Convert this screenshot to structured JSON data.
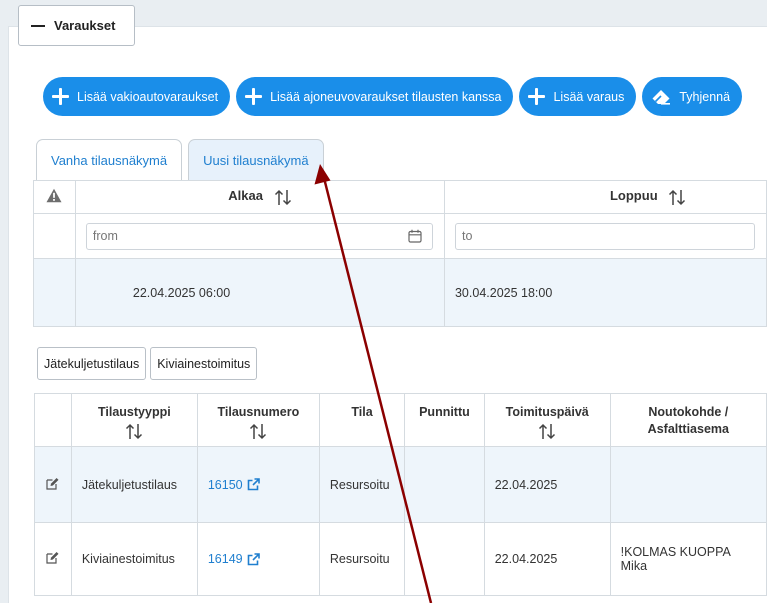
{
  "section": {
    "title": "Varaukset"
  },
  "actions": [
    {
      "label": "Lisää vakioautovaraukset"
    },
    {
      "label": "Lisää ajoneuvovaraukset tilausten kanssa"
    },
    {
      "label": "Lisää varaus"
    },
    {
      "label": "Tyhjennä"
    }
  ],
  "tabs": [
    {
      "label": "Vanha tilausnäkymä"
    },
    {
      "label": "Uusi tilausnäkymä"
    }
  ],
  "period": {
    "columns": {
      "start": "Alkaa",
      "end": "Loppuu"
    },
    "start_placeholder": "from",
    "end_placeholder": "to",
    "start_value": "22.04.2025 06:00",
    "end_value": "30.04.2025 18:00"
  },
  "order_filters": [
    {
      "label": "Jätekuljetustilaus"
    },
    {
      "label": "Kiviainestoimitus"
    }
  ],
  "orders": {
    "headers": {
      "type": "Tilaustyyppi",
      "number": "Tilausnumero",
      "status": "Tila",
      "weighed": "Punnittu",
      "delivery_date": "Toimituspäivä",
      "pickup_line1": "Noutokohde /",
      "pickup_line2": "Asfalttiasema"
    },
    "rows": [
      {
        "type": "Jätekuljetustilaus",
        "number": "16150",
        "status": "Resursoitu",
        "weighed": "",
        "delivery_date": "22.04.2025",
        "pickup_line1": "",
        "pickup_line2": ""
      },
      {
        "type": "Kiviainestoimitus",
        "number": "16149",
        "status": "Resursoitu",
        "weighed": "",
        "delivery_date": "22.04.2025",
        "pickup_line1": "!KOLMAS KUOPPA",
        "pickup_line2": "Mika"
      }
    ]
  },
  "colors": {
    "primary": "#1a8ee9",
    "link": "#1f7fcf",
    "annotation_arrow": "#8b0000"
  }
}
